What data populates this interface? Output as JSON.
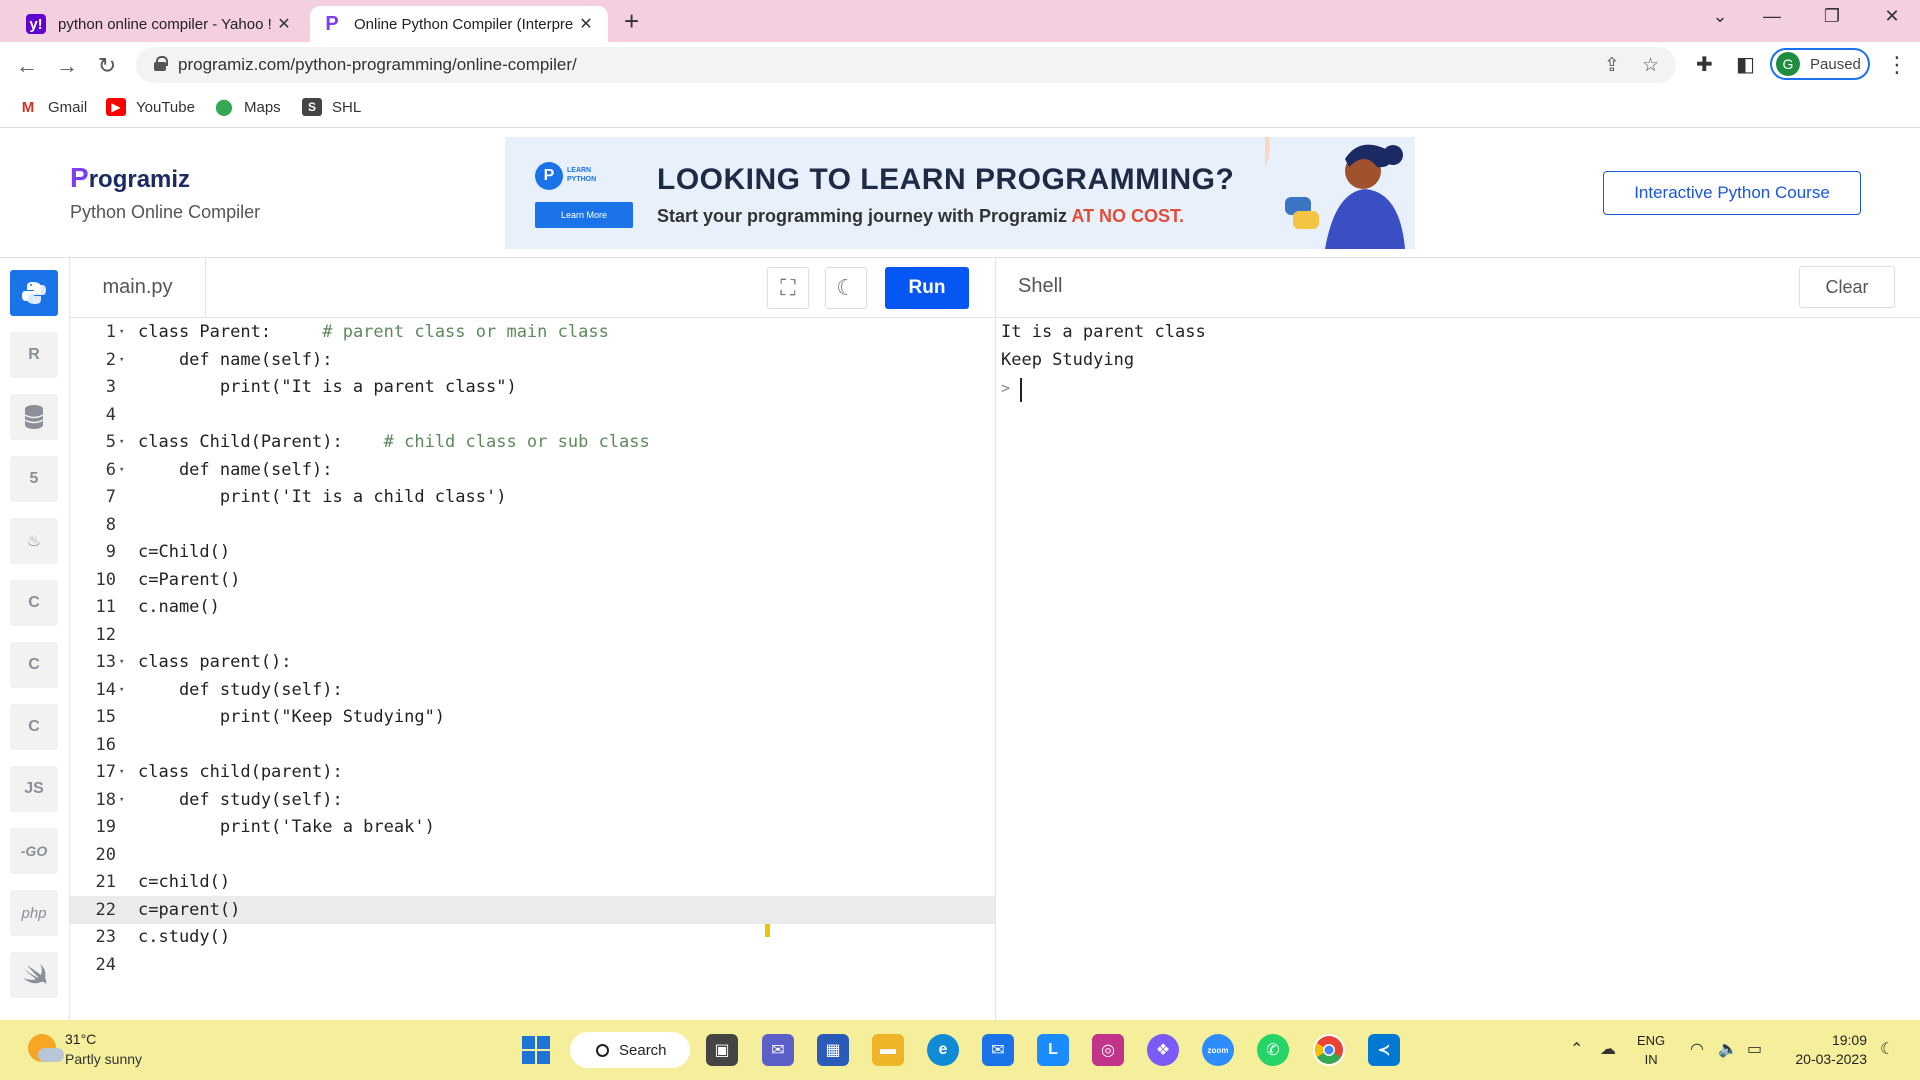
{
  "browser": {
    "tabs": [
      {
        "title": "python online compiler - Yahoo !",
        "active": false
      },
      {
        "title": "Online Python Compiler (Interpre",
        "active": true
      }
    ],
    "new_tab": "+",
    "url": "programiz.com/python-programming/online-compiler/",
    "profile_initial": "G",
    "profile_status": "Paused",
    "bookmarks": [
      {
        "label": "Gmail",
        "icon": "gmail-icon"
      },
      {
        "label": "YouTube",
        "icon": "youtube-icon"
      },
      {
        "label": "Maps",
        "icon": "maps-icon"
      },
      {
        "label": "SHL",
        "icon": "shl-icon"
      }
    ]
  },
  "site": {
    "logo_first": "P",
    "logo_rest": "rogramiz",
    "subtitle": "Python Online Compiler",
    "banner": {
      "badge_line1": "LEARN",
      "badge_line2": "PYTHON",
      "learn_more": "Learn More",
      "heading": "LOOKING TO LEARN PROGRAMMING?",
      "subheading": "Start your programming journey with Programiz ",
      "highlight": "AT NO COST."
    },
    "course_button": "Interactive Python Course"
  },
  "sidebar": {
    "languages": [
      {
        "name": "python-icon",
        "label": "",
        "active": true
      },
      {
        "name": "r-icon",
        "label": "R"
      },
      {
        "name": "sql-icon",
        "label": ""
      },
      {
        "name": "html-icon",
        "label": "5"
      },
      {
        "name": "java-icon",
        "label": "♨"
      },
      {
        "name": "c-icon",
        "label": "C"
      },
      {
        "name": "cpp-icon",
        "label": "C"
      },
      {
        "name": "csharp-icon",
        "label": "C"
      },
      {
        "name": "js-icon",
        "label": "JS"
      },
      {
        "name": "go-icon",
        "label": "-GO"
      },
      {
        "name": "php-icon",
        "label": "php"
      },
      {
        "name": "swift-icon",
        "label": ""
      }
    ]
  },
  "editor": {
    "file_name": "main.py",
    "run_label": "Run",
    "current_line": 22,
    "lines": [
      {
        "n": "1",
        "fold": true,
        "code": "class Parent:     ",
        "comment": "# parent class or main class"
      },
      {
        "n": "2",
        "fold": true,
        "code": "    def name(self):",
        "comment": ""
      },
      {
        "n": "3",
        "fold": false,
        "code": "        print(\"It is a parent class\")",
        "comment": ""
      },
      {
        "n": "4",
        "fold": false,
        "code": "",
        "comment": ""
      },
      {
        "n": "5",
        "fold": true,
        "code": "class Child(Parent):    ",
        "comment": "# child class or sub class"
      },
      {
        "n": "6",
        "fold": true,
        "code": "    def name(self):",
        "comment": ""
      },
      {
        "n": "7",
        "fold": false,
        "code": "        print('It is a child class')",
        "comment": ""
      },
      {
        "n": "8",
        "fold": false,
        "code": "",
        "comment": ""
      },
      {
        "n": "9",
        "fold": false,
        "code": "c=Child()",
        "comment": ""
      },
      {
        "n": "10",
        "fold": false,
        "code": "c=Parent()",
        "comment": ""
      },
      {
        "n": "11",
        "fold": false,
        "code": "c.name()",
        "comment": ""
      },
      {
        "n": "12",
        "fold": false,
        "code": "",
        "comment": ""
      },
      {
        "n": "13",
        "fold": true,
        "code": "class parent():",
        "comment": ""
      },
      {
        "n": "14",
        "fold": true,
        "code": "    def study(self):",
        "comment": ""
      },
      {
        "n": "15",
        "fold": false,
        "code": "        print(\"Keep Studying\")",
        "comment": ""
      },
      {
        "n": "16",
        "fold": false,
        "code": "",
        "comment": ""
      },
      {
        "n": "17",
        "fold": true,
        "code": "class child(parent):",
        "comment": ""
      },
      {
        "n": "18",
        "fold": true,
        "code": "    def study(self):",
        "comment": ""
      },
      {
        "n": "19",
        "fold": false,
        "code": "        print('Take a break')",
        "comment": ""
      },
      {
        "n": "20",
        "fold": false,
        "code": "",
        "comment": ""
      },
      {
        "n": "21",
        "fold": false,
        "code": "c=child()",
        "comment": ""
      },
      {
        "n": "22",
        "fold": false,
        "code": "c=parent()",
        "comment": ""
      },
      {
        "n": "23",
        "fold": false,
        "code": "c.study()",
        "comment": ""
      },
      {
        "n": "24",
        "fold": false,
        "code": "",
        "comment": ""
      }
    ]
  },
  "shell": {
    "title": "Shell",
    "clear_label": "Clear",
    "output": [
      "It is a parent class",
      "Keep Studying"
    ],
    "prompt": ">"
  },
  "taskbar": {
    "temperature": "31°C",
    "condition": "Partly sunny",
    "search_label": "Search",
    "language_line1": "ENG",
    "language_line2": "IN",
    "time": "19:09",
    "date": "20-03-2023"
  },
  "colors": {
    "accent": "#0556f3",
    "tabstrip": "#f4cfe0",
    "taskbar": "#f5ef9c"
  }
}
